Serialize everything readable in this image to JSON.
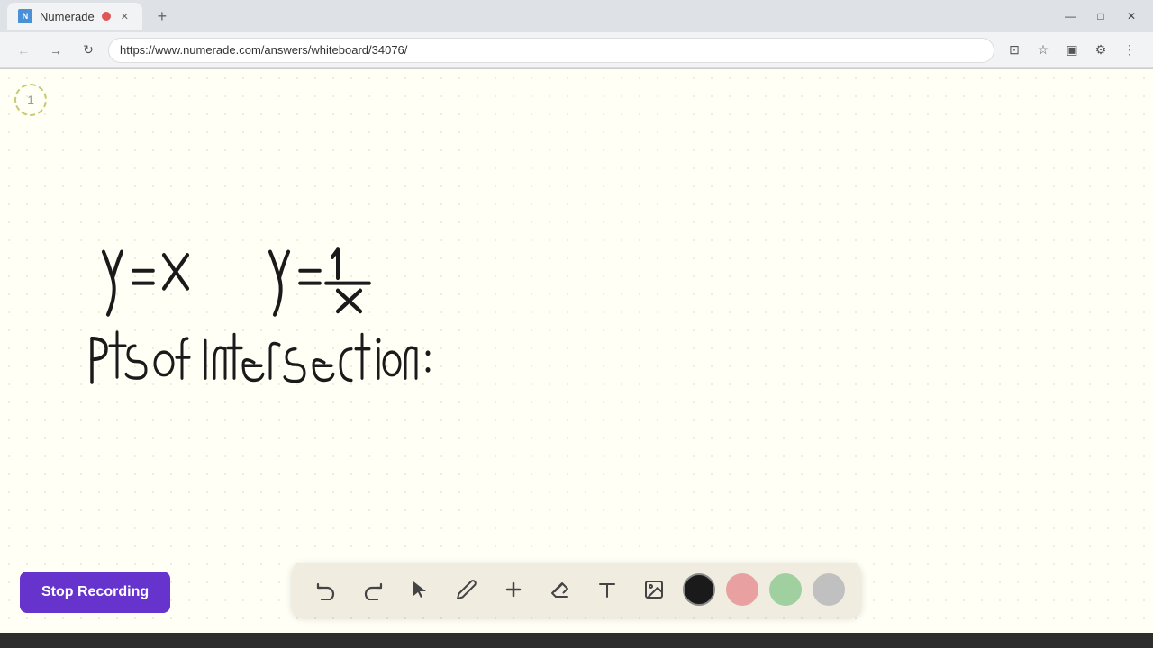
{
  "browser": {
    "tab_title": "Numerade",
    "tab_favicon": "N",
    "url": "https://www.numerade.com/answers/whiteboard/34076/",
    "new_tab_label": "+",
    "page_number": "1"
  },
  "toolbar": {
    "undo_label": "↺",
    "redo_label": "↻",
    "select_label": "▲",
    "pen_label": "✏",
    "add_label": "+",
    "eraser_label": "/",
    "text_label": "A",
    "image_label": "🖼",
    "stop_recording_label": "Stop Recording",
    "colors": {
      "black": "#1a1a1a",
      "pink": "#e8a0a0",
      "green": "#a0d0a0",
      "gray": "#c0c0c0"
    }
  },
  "page": {
    "page_number": "1"
  },
  "window_controls": {
    "minimize": "—",
    "maximize": "□",
    "close": "✕"
  },
  "nav": {
    "back": "←",
    "forward": "→",
    "refresh": "↻"
  }
}
